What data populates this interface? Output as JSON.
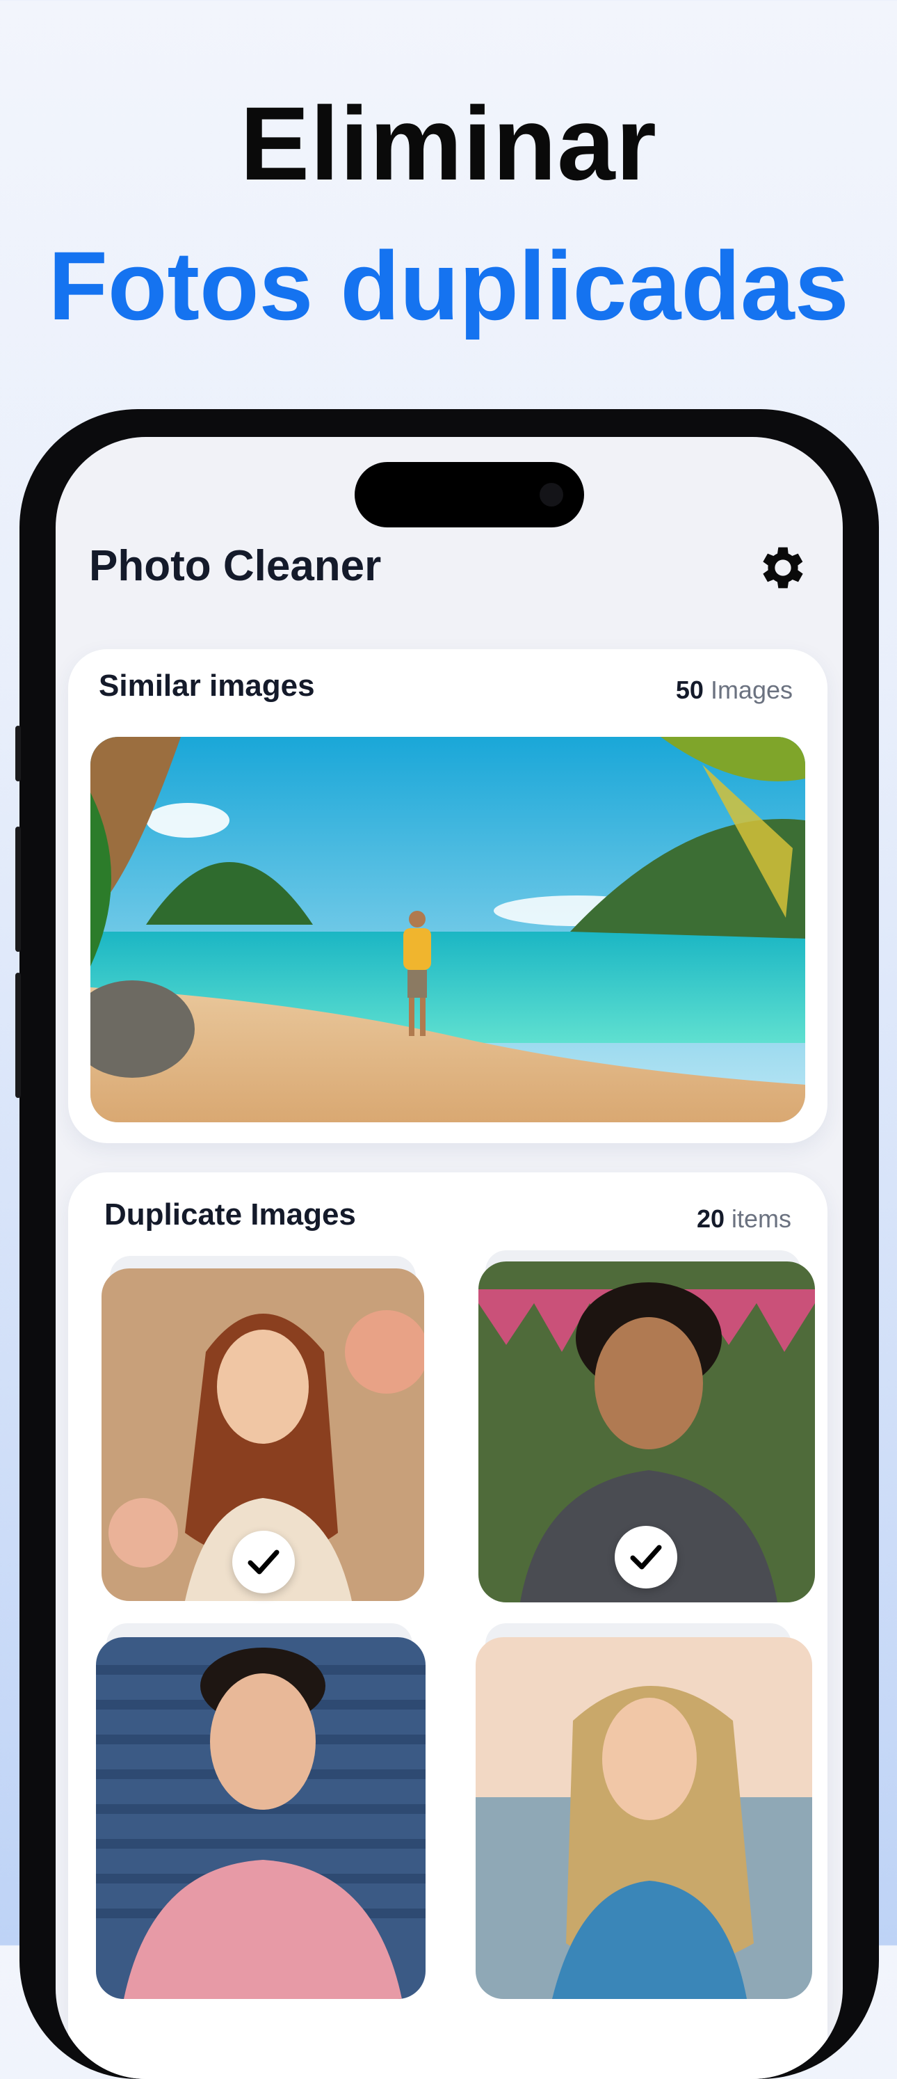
{
  "headline": {
    "line1": "Eliminar",
    "line2": "Fotos duplicadas"
  },
  "app": {
    "title": "Photo Cleaner",
    "settings_icon": "gear-icon"
  },
  "similar": {
    "title": "Similar images",
    "count": "50",
    "unit": "Images"
  },
  "duplicates": {
    "title": "Duplicate Images",
    "count": "20",
    "unit": "items",
    "tiles": [
      {
        "subject": "woman-long-hair-portrait",
        "selected": true
      },
      {
        "subject": "smiling-man-curly-hair",
        "selected": true
      },
      {
        "subject": "smiling-man-pink-shirt",
        "selected": true
      },
      {
        "subject": "woman-beach-portrait",
        "selected": true
      }
    ]
  },
  "colors": {
    "accent": "#1573f0",
    "text_dark": "#141a2a",
    "text_muted": "#6b7280"
  }
}
